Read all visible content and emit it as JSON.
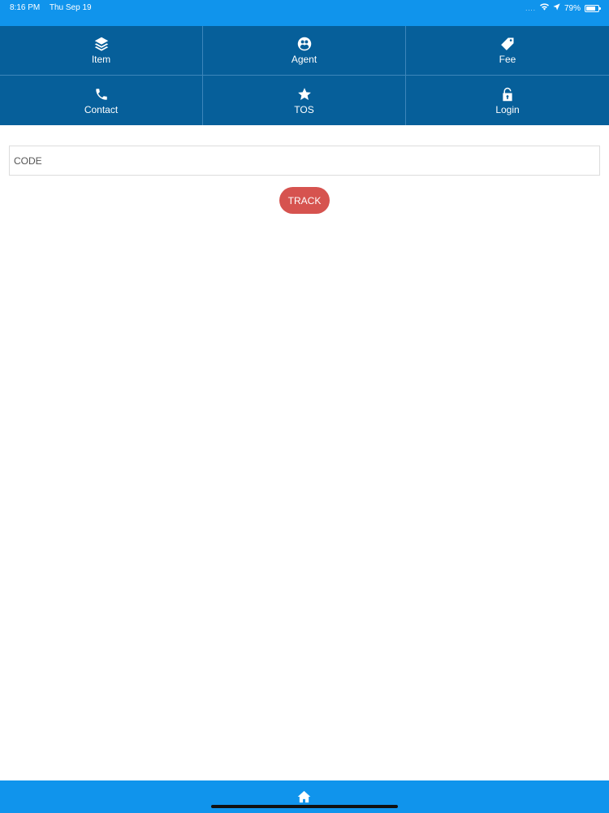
{
  "status_bar": {
    "time": "8:16 PM",
    "date": "Thu Sep 19",
    "signal_dots": "....",
    "battery_percent": "79%",
    "battery_level": 0.79,
    "icons": [
      "wifi-icon",
      "location-arrow-icon",
      "battery-icon"
    ]
  },
  "menu": {
    "items": [
      {
        "label": "Item",
        "icon": "layers-icon"
      },
      {
        "label": "Agent",
        "icon": "users-circle-icon"
      },
      {
        "label": "Fee",
        "icon": "price-tag-icon"
      },
      {
        "label": "Contact",
        "icon": "phone-icon"
      },
      {
        "label": "TOS",
        "icon": "star-icon"
      },
      {
        "label": "Login",
        "icon": "unlock-icon"
      }
    ]
  },
  "tracking": {
    "code_placeholder": "CODE",
    "code_value": "",
    "track_label": "TRACK"
  },
  "bottom_bar": {
    "icon": "home-icon"
  },
  "colors": {
    "top_bar": "#1094ec",
    "menu_bg": "#065f9a",
    "track_button": "#d6534f"
  }
}
